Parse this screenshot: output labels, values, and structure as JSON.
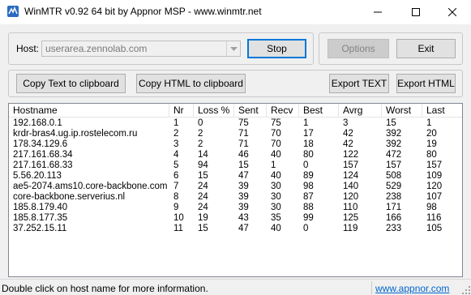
{
  "window": {
    "title": "WinMTR v0.92 64 bit by Appnor MSP - www.winmtr.net"
  },
  "host": {
    "label": "Host:",
    "value": "userarea.zennolab.com"
  },
  "buttons": {
    "stop": "Stop",
    "options": "Options",
    "exit": "Exit",
    "copy_text": "Copy Text to clipboard",
    "copy_html": "Copy HTML to clipboard",
    "export_text": "Export TEXT",
    "export_html": "Export HTML"
  },
  "table": {
    "columns": [
      "Hostname",
      "Nr",
      "Loss %",
      "Sent",
      "Recv",
      "Best",
      "Avrg",
      "Worst",
      "Last"
    ],
    "rows": [
      [
        "192.168.0.1",
        "1",
        "0",
        "75",
        "75",
        "1",
        "3",
        "15",
        "1"
      ],
      [
        "krdr-bras4.ug.ip.rostelecom.ru",
        "2",
        "2",
        "71",
        "70",
        "17",
        "42",
        "392",
        "20"
      ],
      [
        "178.34.129.6",
        "3",
        "2",
        "71",
        "70",
        "18",
        "42",
        "392",
        "19"
      ],
      [
        "217.161.68.34",
        "4",
        "14",
        "46",
        "40",
        "80",
        "122",
        "472",
        "80"
      ],
      [
        "217.161.68.33",
        "5",
        "94",
        "15",
        "1",
        "0",
        "157",
        "157",
        "157"
      ],
      [
        "5.56.20.113",
        "6",
        "15",
        "47",
        "40",
        "89",
        "124",
        "508",
        "109"
      ],
      [
        "ae5-2074.ams10.core-backbone.com",
        "7",
        "24",
        "39",
        "30",
        "98",
        "140",
        "529",
        "120"
      ],
      [
        "core-backbone.serverius.nl",
        "8",
        "24",
        "39",
        "30",
        "87",
        "120",
        "238",
        "107"
      ],
      [
        "185.8.179.40",
        "9",
        "24",
        "39",
        "30",
        "88",
        "110",
        "171",
        "98"
      ],
      [
        "185.8.177.35",
        "10",
        "19",
        "43",
        "35",
        "99",
        "125",
        "166",
        "116"
      ],
      [
        "37.252.15.11",
        "11",
        "15",
        "47",
        "40",
        "0",
        "119",
        "233",
        "105"
      ]
    ]
  },
  "status": {
    "text": "Double click on host name for more information.",
    "link": "www.appnor.com"
  },
  "colors": {
    "focus_border": "#0078d7",
    "link": "#0066cc",
    "disabled_text": "#838383"
  },
  "icons": [
    "winmtr-app-icon",
    "minimize-icon",
    "maximize-icon",
    "close-icon",
    "dropdown-arrow-icon",
    "size-grip-icon"
  ]
}
